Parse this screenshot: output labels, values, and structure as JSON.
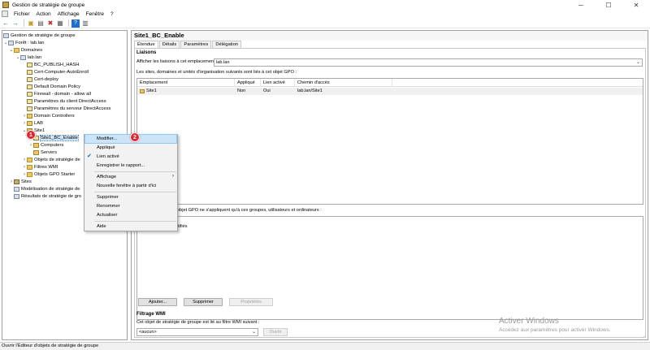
{
  "window": {
    "title": "Gestion de stratégie de groupe",
    "minimize": "─",
    "maximize": "☐",
    "close": "✕"
  },
  "menubar": {
    "items": [
      "Fichier",
      "Action",
      "Affichage",
      "Fenêtre",
      "?"
    ]
  },
  "toolbar": {
    "back": "←",
    "forward": "→",
    "up": "▣",
    "show_hide": "▤",
    "delete": "✖",
    "properties": "▦",
    "help": "?",
    "export": "▥"
  },
  "tree": {
    "root": "Gestion de stratégie de groupe",
    "forest": "Forêt : lab.lan",
    "domains": "Domaines",
    "domain": "lab.lan",
    "gpos": [
      "BC_PUBLISH_HASH",
      "Cert-Computer-AutoEnroll",
      "Cert-deploy",
      "Default Domain Policy",
      "Firewall - domain - allow all",
      "Paramètres du client DirectAccess",
      "Paramètres du serveur DirectAccess"
    ],
    "domain_controllers": "Domain Controllers",
    "lab": "LAB",
    "site1": "Site1",
    "site1_bc_enable": "Site1_BC_Enable",
    "computers": "Computers",
    "servers": "Servers",
    "objets_strategie": "Objets de stratégie de",
    "filtres_wmi": "Filtres WMI",
    "objets_starter": "Objets GPO Starter",
    "sites": "Sites",
    "modelisation": "Modélisation de stratégie de",
    "resultats": "Résultats de stratégie de gro"
  },
  "panel": {
    "title": "Site1_BC_Enable",
    "tabs": [
      "Étendue",
      "Détails",
      "Paramètres",
      "Délégation"
    ],
    "liaisons": {
      "title": "Liaisons",
      "show_links_label": "Afficher les liaisons à cet emplacement :",
      "location_value": "lab.lan",
      "description": "Les sites, domaines et unités d'organisation suivants sont liés à cet objet GPO :",
      "columns": [
        "Emplacement",
        "Appliqué",
        "Lien activé",
        "Chemin d'accès"
      ],
      "rows": [
        {
          "location": "Site1",
          "enforced": "Non",
          "enabled": "Oui",
          "path": "lab.lan/Site1"
        }
      ]
    },
    "filtrage_securite": {
      "partial_text": "objet GPO ne s'appliquent qu'à ces groupes, utilisateurs et ordinateurs :",
      "partial_item": "tifiés"
    },
    "buttons": {
      "add": "Ajouter...",
      "remove": "Supprimer",
      "properties": "Propriétés"
    },
    "filtrage_wmi": {
      "title": "Filtrage WMI",
      "description": "Cet objet de stratégie de groupe est lié au filtre WMI suivant :",
      "value": "<aucun>",
      "open": "Ouvrir"
    }
  },
  "context_menu": {
    "items": [
      "Modifier...",
      "Appliqué",
      "Lien activé",
      "Enregistrer le rapport...",
      "Affichage",
      "Nouvelle fenêtre à partir d'ici",
      "Supprimer",
      "Renommer",
      "Actualiser",
      "Aide"
    ],
    "checked": "Lien activé",
    "highlighted": "Modifier..."
  },
  "badges": [
    "1",
    "2"
  ],
  "status": "Ouvrir l'Éditeur d'objets de stratégie de groupe",
  "watermark": {
    "line1": "Activer Windows",
    "line2": "Accédez aux paramètres pour activer Windows."
  },
  "colors": {
    "highlight": "#cce4f7",
    "badge": "#e0262e",
    "check": "#1a5fb4"
  }
}
